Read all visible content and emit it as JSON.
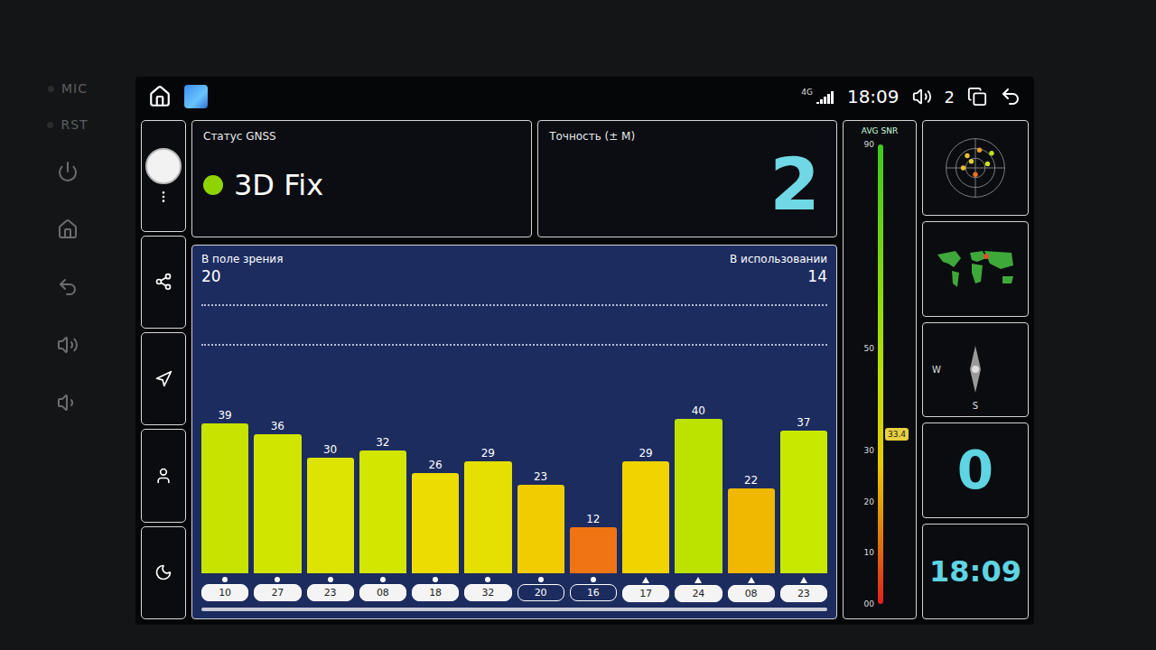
{
  "device": {
    "labels": [
      "MIC",
      "RST"
    ]
  },
  "status_bar": {
    "network": "4G",
    "time": "18:09",
    "volume": "2"
  },
  "gnss_status": {
    "title": "Статус GNSS",
    "value": "3D Fix",
    "color": "#8fd400"
  },
  "accuracy": {
    "title": "Точность (± М)",
    "value": "2"
  },
  "chart": {
    "in_view_label": "В поле зрения",
    "in_view": "20",
    "in_use_label": "В использовании",
    "in_use": "14",
    "satellites": [
      {
        "id": "10",
        "snr": 39,
        "label": "39",
        "used": true,
        "kind": "gps",
        "color": "#c6e400"
      },
      {
        "id": "27",
        "snr": 36,
        "label": "36",
        "used": true,
        "kind": "gps",
        "color": "#d0e600"
      },
      {
        "id": "23",
        "snr": 30,
        "label": "30",
        "used": true,
        "kind": "gps",
        "color": "#dde400"
      },
      {
        "id": "08",
        "snr": 32,
        "label": "32",
        "used": true,
        "kind": "gps",
        "color": "#d2e600"
      },
      {
        "id": "18",
        "snr": 26,
        "label": "26",
        "used": true,
        "kind": "gps",
        "color": "#ecdc00"
      },
      {
        "id": "32",
        "snr": 29,
        "label": "29",
        "used": true,
        "kind": "gps",
        "color": "#e6e000"
      },
      {
        "id": "20",
        "snr": 23,
        "label": "23",
        "used": false,
        "kind": "gps",
        "color": "#f0cc00"
      },
      {
        "id": "16",
        "snr": 12,
        "label": "12",
        "used": false,
        "kind": "gps",
        "color": "#f07414"
      },
      {
        "id": "17",
        "snr": 29,
        "label": "29",
        "used": true,
        "kind": "glonass",
        "color": "#f0d400"
      },
      {
        "id": "24",
        "snr": 40,
        "label": "40",
        "used": true,
        "kind": "glonass",
        "color": "#bce200"
      },
      {
        "id": "08",
        "snr": 22,
        "label": "22",
        "used": true,
        "kind": "glonass",
        "color": "#f0b800"
      },
      {
        "id": "23",
        "snr": 37,
        "label": "37",
        "used": true,
        "kind": "glonass",
        "color": "#c8e800"
      }
    ]
  },
  "gauge": {
    "title": "AVG SNR",
    "ticks": [
      "90",
      "50",
      "30",
      "20",
      "10",
      "00"
    ],
    "reading": "33.4",
    "level": 0.37
  },
  "tiles": {
    "compass": {
      "labels": [
        "W",
        "S"
      ]
    },
    "speed": "0",
    "clock": "18:09"
  }
}
